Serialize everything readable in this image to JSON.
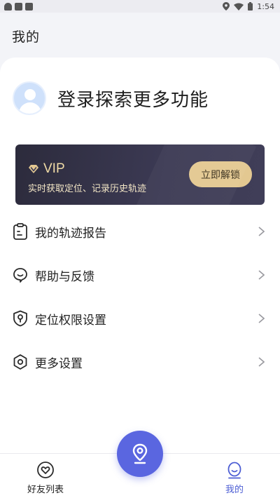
{
  "status_bar": {
    "time": "1:54",
    "icons": [
      "notification-icon",
      "sd-card-icon",
      "app-icon",
      "location-icon",
      "wifi-icon",
      "battery-icon"
    ]
  },
  "header": {
    "title": "我的"
  },
  "profile": {
    "login_prompt": "登录探索更多功能",
    "avatar_icon": "avatar-placeholder-icon"
  },
  "vip": {
    "label": "VIP",
    "description": "实时获取定位、记录历史轨迹",
    "unlock_button": "立即解锁",
    "accent_color": "#e3c891"
  },
  "menu": {
    "items": [
      {
        "label": "我的轨迹报告",
        "icon": "report-clipboard-icon"
      },
      {
        "label": "帮助与反馈",
        "icon": "help-chat-icon"
      },
      {
        "label": "定位权限设置",
        "icon": "shield-location-icon"
      },
      {
        "label": "更多设置",
        "icon": "hexagon-settings-icon"
      }
    ]
  },
  "bottom_nav": {
    "items": [
      {
        "label": "好友列表",
        "icon": "heart-friends-icon",
        "active": false
      },
      {
        "label": "我的",
        "icon": "profile-face-icon",
        "active": true
      }
    ],
    "center_button_icon": "map-pin-icon",
    "active_color": "#4d5ed4",
    "fab_color": "#5a66e0"
  }
}
